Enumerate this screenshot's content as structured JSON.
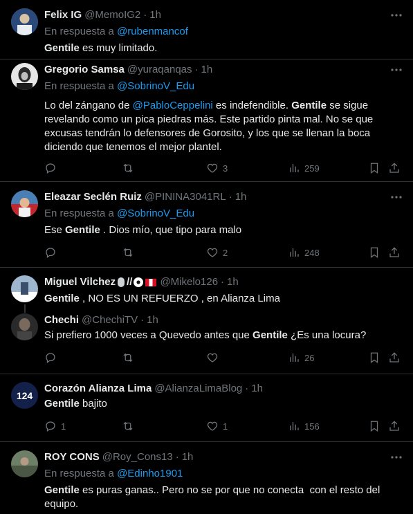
{
  "tweets": [
    {
      "name": "Felix IG",
      "handle": "@MemoIG2",
      "time": "1h",
      "reply_prefix": "En respuesta a",
      "reply_to": "@rubenmancof",
      "body_bold": "Gentile",
      "body_rest": " es muy limitado.",
      "avatar_color": "#3b5d8c"
    },
    {
      "name": "Gregorio Samsa",
      "handle": "@yuraqanqas",
      "time": "1h",
      "reply_prefix": "En respuesta a",
      "reply_to": "@SobrinoV_Edu",
      "body_a": "Lo del zángano de ",
      "body_mention": "@PabloCeppelini",
      "body_b": " es indefendible. ",
      "body_bold": "Gentile",
      "body_c": " se sigue revelando como un pica piedras más. Este partido pinta mal. No se que excusas tendrán lo defensores de Gorosito, y los que se llenan la boca diciendo que tenemos el mejor plantel.",
      "likes": "3",
      "views": "259",
      "avatar_color": "#d9d9d9"
    },
    {
      "name": "Eleazar Seclén Ruiz",
      "handle": "@PININA3041RL",
      "time": "1h",
      "reply_prefix": "En respuesta a",
      "reply_to": "@SobrinoV_Edu",
      "body_a": "Ese ",
      "body_bold": "Gentile",
      "body_c": " . Dios mío, que tipo para malo",
      "likes": "2",
      "views": "248",
      "avatar_color": "#c1272d"
    },
    {
      "name": "Miguel Vilchez",
      "name_suffix": "//",
      "handle": "@Mikelo126",
      "time": "1h",
      "body_bold": "Gentile",
      "body_c": " , NO ES UN REFUERZO , en Alianza Lima",
      "avatar_color": "#8fa6c2"
    },
    {
      "name": "Chechi",
      "handle": "@ChechiTV",
      "time": "1h",
      "body_a": "Si prefiero 1000 veces a Quevedo antes que ",
      "body_bold": "Gentile",
      "body_c": " ¿Es una locura?",
      "views": "26",
      "avatar_color": "#3a3a3a"
    },
    {
      "name": "Corazón Alianza Lima",
      "handle": "@AlianzaLimaBlog",
      "time": "1h",
      "body_bold": "Gentile",
      "body_c": " bajito",
      "avatar_text": "124",
      "replies": "1",
      "likes": "1",
      "views": "156",
      "avatar_color": "#13204a"
    },
    {
      "name": "ROY CONS",
      "handle": "@Roy_Cons13",
      "time": "1h",
      "reply_prefix": "En respuesta a",
      "reply_to": "@Edinho1901",
      "body_bold": "Gentile",
      "body_c": " es puras ganas.. Pero no se por que no conecta  con el resto del equipo.",
      "avatar_color": "#5b6e57"
    }
  ],
  "separator": "·"
}
